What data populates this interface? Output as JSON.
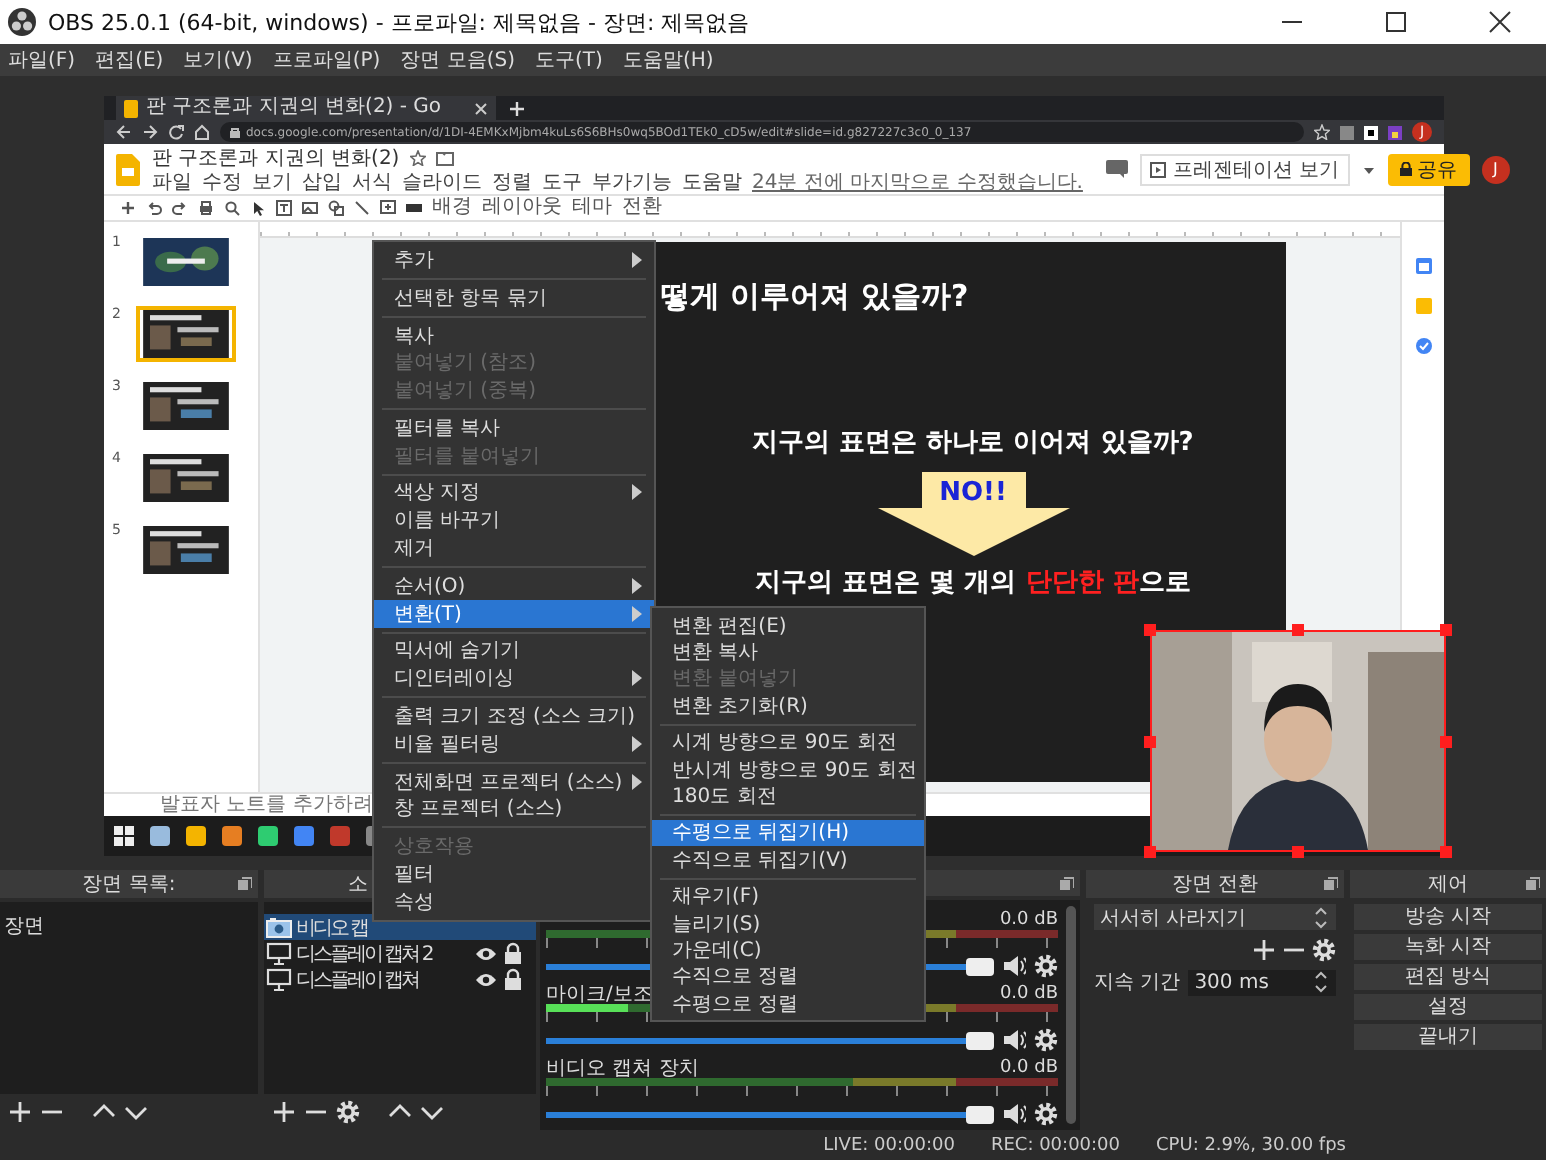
{
  "window": {
    "title": "OBS 25.0.1 (64-bit, windows) - 프로파일: 제목없음 - 장면: 제목없음"
  },
  "menu_bar": [
    "파일(F)",
    "편집(E)",
    "보기(V)",
    "프로파일(P)",
    "장면 모음(S)",
    "도구(T)",
    "도움말(H)"
  ],
  "preview": {
    "captured_screen": {
      "browser_tab": "판 구조론과 지권의 변화(2) - Go",
      "url": "docs.google.com/presentation/d/1DI-4EMKxMjbm4kuLs6S6BHs0wq5BOd1TEk0_cD5w/edit#slide=id.g827227c3c0_0_137",
      "browser_avatar": "J",
      "doc_title": "판 구조론과 지권의 변화(2)",
      "doc_menus": [
        "파일",
        "수정",
        "보기",
        "삽입",
        "서식",
        "슬라이드",
        "정렬",
        "도구",
        "부가기능",
        "도움말"
      ],
      "last_edit": "24분 전에 마지막으로 수정했습니다.",
      "present_button": "프레젠테이션 보기",
      "share_button": "공유",
      "avatar": "J",
      "toolbar_labels": [
        "배경",
        "레이아웃",
        "테마",
        "전환"
      ],
      "thumbnails": [
        {
          "number": "1",
          "selected": false
        },
        {
          "number": "2",
          "selected": true
        },
        {
          "number": "3",
          "selected": false
        },
        {
          "number": "4",
          "selected": false
        },
        {
          "number": "5",
          "selected": false
        }
      ],
      "slide": {
        "title": "떻게 이루어져 있을까?",
        "question": "지구의 표면은 하나로 이어져 있을까?",
        "arrow_text": "NO!!",
        "answer": [
          {
            "text": "지구의 표면은 몇 개의 ",
            "highlight": false
          },
          {
            "text": "단단한 판",
            "highlight": true
          },
          {
            "text": "으로",
            "highlight": false
          }
        ]
      },
      "notes": "발표자 노트를 추가하려"
    },
    "camera": {
      "kind": "picture",
      "selected": true
    }
  },
  "scenes": {
    "title": "장면 목록:",
    "items": [
      {
        "name": "장면",
        "selected": false
      }
    ]
  },
  "sources": {
    "title": "소",
    "items": [
      {
        "name": "비디오 캡",
        "kind": "camera",
        "selected": true
      },
      {
        "name": "디스플레이 캡쳐 2",
        "kind": "display",
        "selected": false
      },
      {
        "name": "디스플레이 캡쳐",
        "kind": "display",
        "selected": false
      }
    ]
  },
  "mixer": {
    "channels": [
      {
        "reading": "0.0 dB",
        "meter": {
          "level": 0
        },
        "volume": {
          "level": 1
        }
      },
      {
        "name": "마이크/보조",
        "reading": "0.0 dB",
        "meter": {
          "level": 0.16
        },
        "volume": {
          "level": 1
        }
      },
      {
        "name": "비디오 캡쳐 장치",
        "reading": "0.0 dB",
        "meter": {
          "level": 0
        },
        "volume": {
          "level": 1
        }
      }
    ]
  },
  "transitions": {
    "title": "장면 전환",
    "transition": "서서히 사라지기",
    "duration_label": "지속 기간",
    "duration": "300 ms"
  },
  "controls": {
    "title": "제어",
    "buttons": [
      "방송 시작",
      "녹화 시작",
      "편집 방식",
      "설정",
      "끝내기"
    ]
  },
  "status_bar": {
    "live": "LIVE: 00:00:00",
    "rec": "REC: 00:00:00",
    "cpu": "CPU: 2.9%, 30.00 fps"
  },
  "context_menu": {
    "items": [
      {
        "kind": "item",
        "label": "추가",
        "has_submenu": true,
        "disabled": false,
        "selected": false
      },
      {
        "kind": "separator"
      },
      {
        "kind": "item",
        "label": "선택한 항목 묶기",
        "has_submenu": false,
        "disabled": false,
        "selected": false
      },
      {
        "kind": "separator"
      },
      {
        "kind": "item",
        "label": "복사",
        "has_submenu": false,
        "disabled": false,
        "selected": false
      },
      {
        "kind": "item",
        "label": "붙여넣기 (참조)",
        "has_submenu": false,
        "disabled": true,
        "selected": false
      },
      {
        "kind": "item",
        "label": "붙여넣기 (중복)",
        "has_submenu": false,
        "disabled": true,
        "selected": false
      },
      {
        "kind": "separator"
      },
      {
        "kind": "item",
        "label": "필터를 복사",
        "has_submenu": false,
        "disabled": false,
        "selected": false
      },
      {
        "kind": "item",
        "label": "필터를 붙여넣기",
        "has_submenu": false,
        "disabled": true,
        "selected": false
      },
      {
        "kind": "separator"
      },
      {
        "kind": "item",
        "label": "색상 지정",
        "has_submenu": true,
        "disabled": false,
        "selected": false
      },
      {
        "kind": "item",
        "label": "이름 바꾸기",
        "has_submenu": false,
        "disabled": false,
        "selected": false
      },
      {
        "kind": "item",
        "label": "제거",
        "has_submenu": false,
        "disabled": false,
        "selected": false
      },
      {
        "kind": "separator"
      },
      {
        "kind": "item",
        "label": "순서(O)",
        "has_submenu": true,
        "disabled": false,
        "selected": false
      },
      {
        "kind": "item",
        "label": "변환(T)",
        "has_submenu": true,
        "disabled": false,
        "selected": true
      },
      {
        "kind": "separator"
      },
      {
        "kind": "item",
        "label": "믹서에 숨기기",
        "has_submenu": false,
        "disabled": false,
        "selected": false
      },
      {
        "kind": "item",
        "label": "디인터레이싱",
        "has_submenu": true,
        "disabled": false,
        "selected": false
      },
      {
        "kind": "separator"
      },
      {
        "kind": "item",
        "label": "출력 크기 조정 (소스 크기)",
        "has_submenu": false,
        "disabled": false,
        "selected": false
      },
      {
        "kind": "item",
        "label": "비율 필터링",
        "has_submenu": true,
        "disabled": false,
        "selected": false
      },
      {
        "kind": "separator"
      },
      {
        "kind": "item",
        "label": "전체화면 프로젝터 (소스)",
        "has_submenu": true,
        "disabled": false,
        "selected": false
      },
      {
        "kind": "item",
        "label": "창 프로젝터 (소스)",
        "has_submenu": false,
        "disabled": false,
        "selected": false
      },
      {
        "kind": "separator"
      },
      {
        "kind": "item",
        "label": "상호작용",
        "has_submenu": false,
        "disabled": true,
        "selected": false
      },
      {
        "kind": "item",
        "label": "필터",
        "has_submenu": false,
        "disabled": false,
        "selected": false
      },
      {
        "kind": "item",
        "label": "속성",
        "has_submenu": false,
        "disabled": false,
        "selected": false
      }
    ],
    "submenu": {
      "items": [
        {
          "kind": "item",
          "label": "변환 편집(E)",
          "disabled": false,
          "selected": false
        },
        {
          "kind": "item",
          "label": "변환 복사",
          "disabled": false,
          "selected": false
        },
        {
          "kind": "item",
          "label": "변환 붙여넣기",
          "disabled": true,
          "selected": false
        },
        {
          "kind": "item",
          "label": "변환 초기화(R)",
          "disabled": false,
          "selected": false
        },
        {
          "kind": "separator"
        },
        {
          "kind": "item",
          "label": "시계 방향으로 90도 회전",
          "disabled": false,
          "selected": false
        },
        {
          "kind": "item",
          "label": "반시계 방향으로 90도 회전",
          "disabled": false,
          "selected": false
        },
        {
          "kind": "item",
          "label": "180도 회전",
          "disabled": false,
          "selected": false
        },
        {
          "kind": "separator"
        },
        {
          "kind": "item",
          "label": "수평으로 뒤집기(H)",
          "disabled": false,
          "selected": true
        },
        {
          "kind": "item",
          "label": "수직으로 뒤집기(V)",
          "disabled": false,
          "selected": false
        },
        {
          "kind": "separator"
        },
        {
          "kind": "item",
          "label": "채우기(F)",
          "disabled": false,
          "selected": false
        },
        {
          "kind": "item",
          "label": "늘리기(S)",
          "disabled": false,
          "selected": false
        },
        {
          "kind": "item",
          "label": "가운데(C)",
          "disabled": false,
          "selected": false
        },
        {
          "kind": "item",
          "label": "수직으로 정렬",
          "disabled": false,
          "selected": false
        },
        {
          "kind": "item",
          "label": "수평으로 정렬",
          "disabled": false,
          "selected": false
        }
      ]
    }
  }
}
